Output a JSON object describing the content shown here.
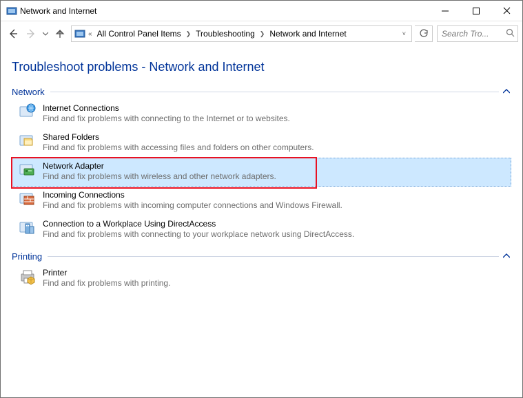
{
  "titlebar": {
    "icon": "control-panel-icon",
    "title": "Network and Internet"
  },
  "nav": {
    "breadcrumb_prefix": "«",
    "breadcrumb": [
      "All Control Panel Items",
      "Troubleshooting",
      "Network and Internet"
    ],
    "search_placeholder": "Search Tro..."
  },
  "page": {
    "title": "Troubleshoot problems - Network and Internet"
  },
  "sections": [
    {
      "title": "Network",
      "items": [
        {
          "icon": "globe-icon",
          "title": "Internet Connections",
          "desc": "Find and fix problems with connecting to the Internet or to websites."
        },
        {
          "icon": "shared-folder-icon",
          "title": "Shared Folders",
          "desc": "Find and fix problems with accessing files and folders on other computers."
        },
        {
          "icon": "adapter-icon",
          "title": "Network Adapter",
          "desc": "Find and fix problems with wireless and other network adapters.",
          "highlight": true
        },
        {
          "icon": "firewall-icon",
          "title": "Incoming Connections",
          "desc": "Find and fix problems with incoming computer connections and Windows Firewall."
        },
        {
          "icon": "workplace-icon",
          "title": "Connection to a Workplace Using DirectAccess",
          "desc": "Find and fix problems with connecting to your workplace network using DirectAccess."
        }
      ]
    },
    {
      "title": "Printing",
      "items": [
        {
          "icon": "printer-icon",
          "title": "Printer",
          "desc": "Find and fix problems with printing."
        }
      ]
    }
  ]
}
